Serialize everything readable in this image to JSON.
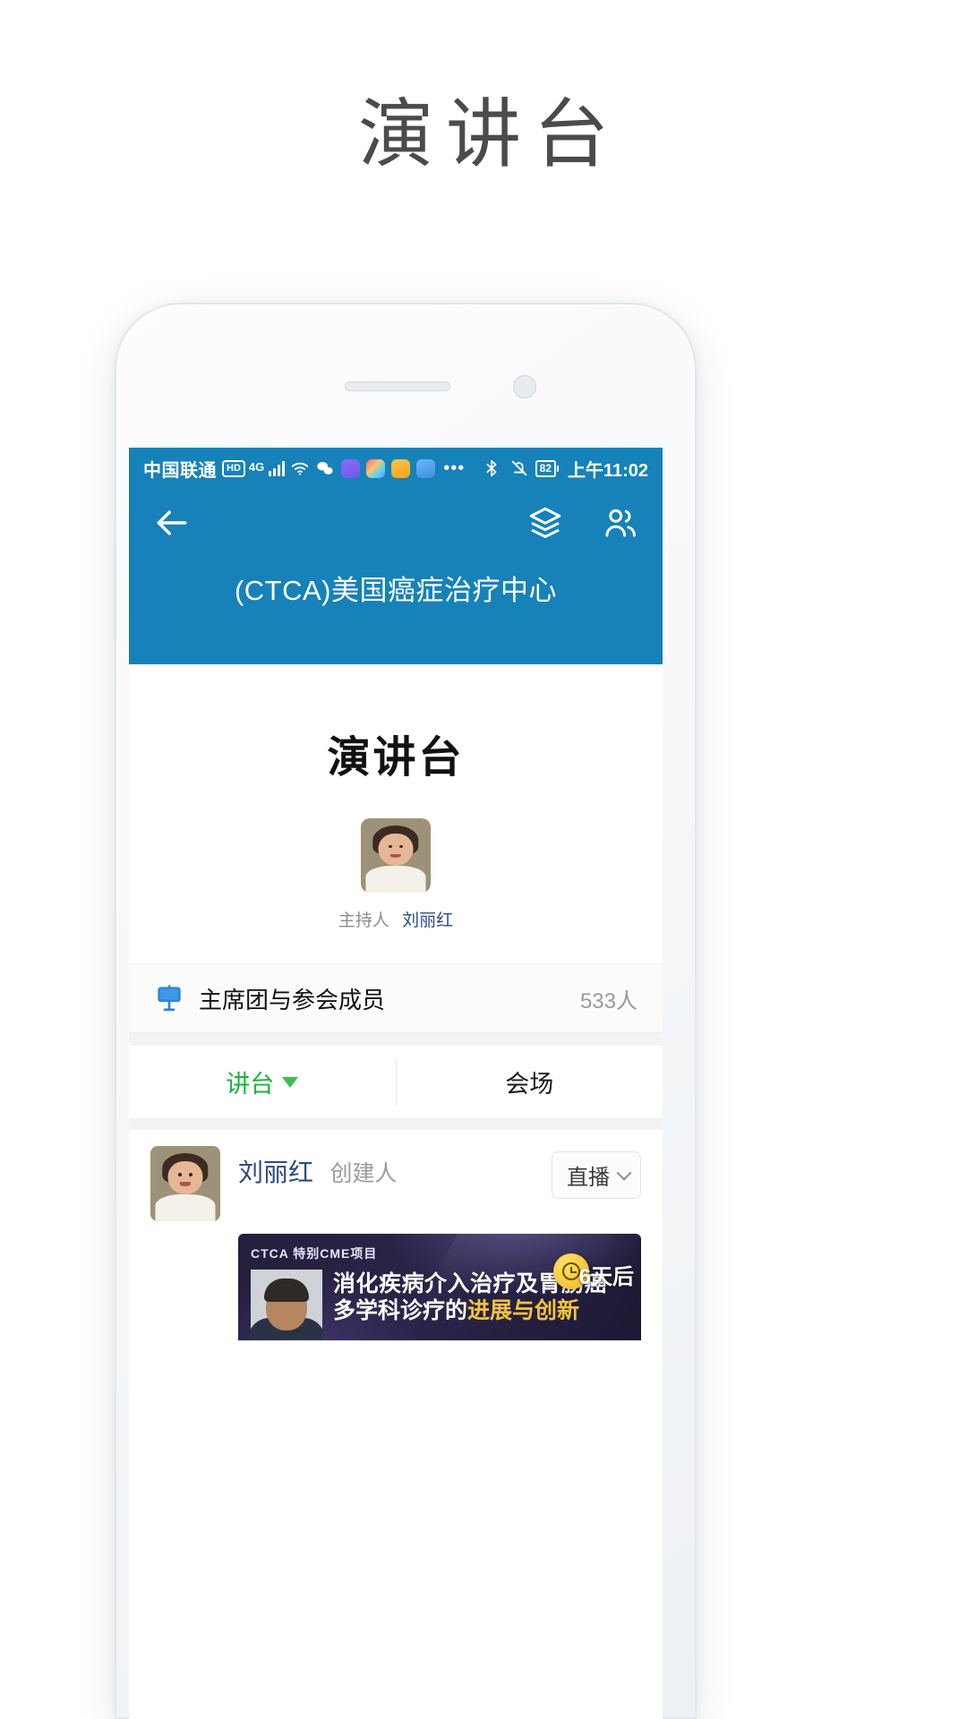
{
  "page": {
    "title": "演讲台"
  },
  "statusbar": {
    "carrier": "中国联通",
    "hd_badge": "HD",
    "network": "4G",
    "battery": "82",
    "time": "上午11:02",
    "icons": [
      "signal-bars-icon",
      "wifi-icon",
      "wechat-icon",
      "music-app-icon",
      "rainbow-app-icon",
      "yellow-app-icon",
      "cloud-app-icon",
      "more-dots-icon",
      "bluetooth-icon",
      "mute-bell-icon",
      "battery-icon"
    ]
  },
  "app_header": {
    "back_icon": "back-arrow-icon",
    "layers_icon": "layers-icon",
    "people_icon": "people-icon",
    "title": "(CTCA)美国癌症治疗中心",
    "background_color": "#1682b9"
  },
  "stage": {
    "title": "演讲台",
    "host_label": "主持人",
    "host_name": "刘丽红",
    "avatar_icon": "host-avatar"
  },
  "members": {
    "icon": "presentation-board-icon",
    "label": "主席团与参会成员",
    "count": "533人"
  },
  "tabs": [
    {
      "label": "讲台",
      "active": true,
      "has_caret": true,
      "color": "#19b23c"
    },
    {
      "label": "会场",
      "active": false,
      "has_caret": false,
      "color": "#1a1a1a"
    }
  ],
  "post": {
    "author": "刘丽红",
    "role": "创建人",
    "action_label": "直播",
    "action_caret": "chevron-down-icon",
    "banner": {
      "kicker": "CTCA 特别CME项目",
      "line1": "消化疾病介入治疗及胃肠癌",
      "line2_prefix": "多学科诊疗的",
      "line2_highlight": "进展与创新",
      "countdown": "6天后",
      "clock_icon": "clock-badge-icon",
      "highlight_color": "#f3c33c"
    }
  }
}
